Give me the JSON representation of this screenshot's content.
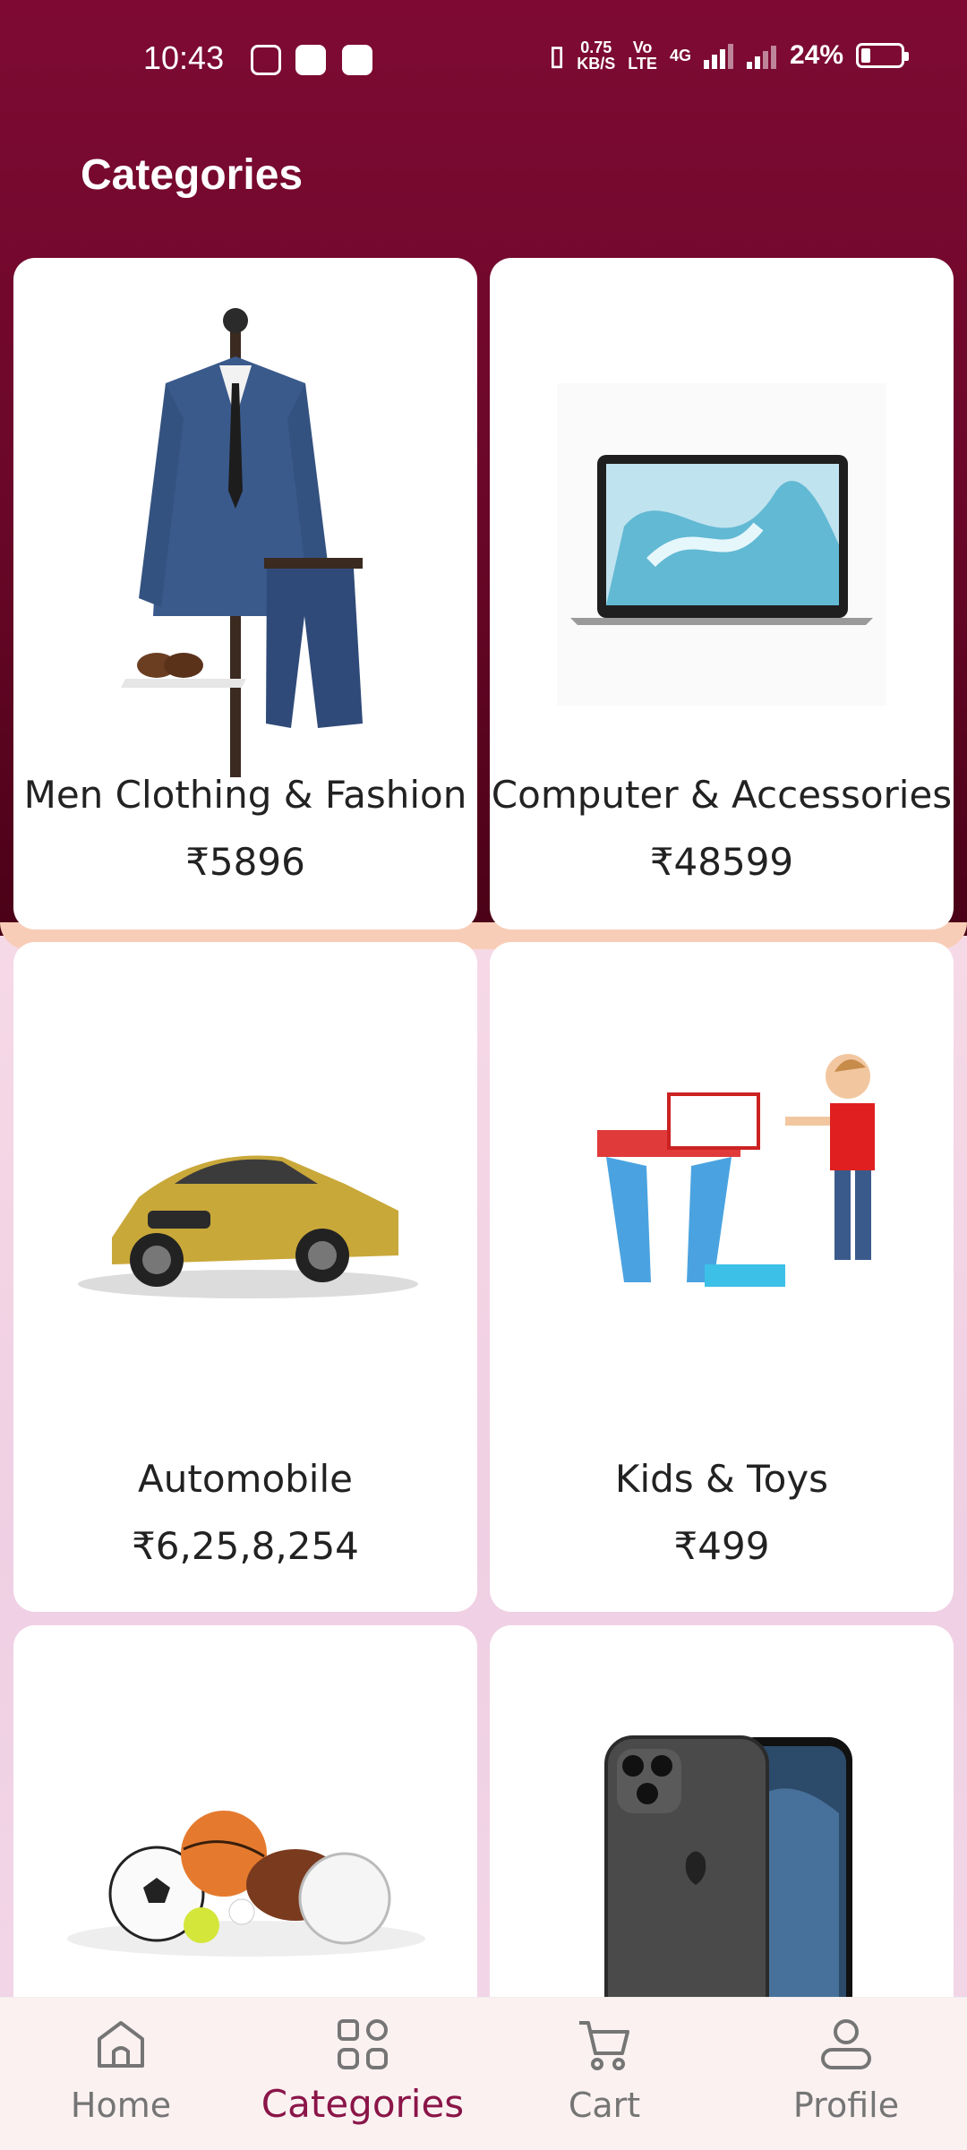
{
  "status_bar": {
    "time": "10:43",
    "network_speed_top": "0.75",
    "network_speed_bottom": "KB/S",
    "volte_top": "Vo",
    "volte_bottom": "LTE",
    "signal_label": "4G",
    "battery": "24%"
  },
  "header": {
    "title": "Categories"
  },
  "categories": [
    {
      "name": "Men Clothing & Fashion",
      "price": "₹5896",
      "icon": "suit-image"
    },
    {
      "name": "Computer & Accessories",
      "price": "₹48599",
      "icon": "laptop-image"
    },
    {
      "name": "Automobile",
      "price": "₹6,25,8,254",
      "icon": "car-image"
    },
    {
      "name": "Kids & Toys",
      "price": "₹499",
      "icon": "toy-desk-image"
    },
    {
      "name": "",
      "price": "",
      "icon": "sports-balls-image"
    },
    {
      "name": "",
      "price": "",
      "icon": "smartphone-image"
    }
  ],
  "bottom_nav": {
    "items": [
      {
        "label": "Home",
        "icon": "home-icon"
      },
      {
        "label": "Categories",
        "icon": "grid-icon",
        "active": true
      },
      {
        "label": "Cart",
        "icon": "cart-icon"
      },
      {
        "label": "Profile",
        "icon": "profile-icon"
      }
    ]
  },
  "colors": {
    "header_bg": "#6a0728",
    "active_nav": "#8a1548",
    "inactive_nav": "#757575"
  }
}
